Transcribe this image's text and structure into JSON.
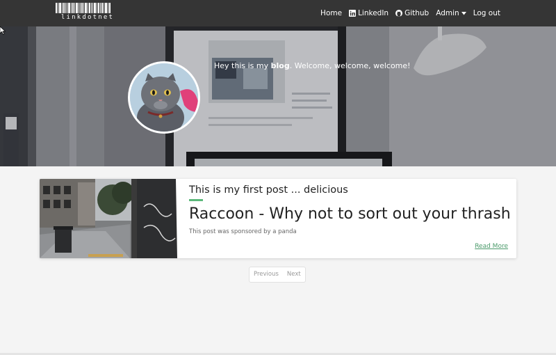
{
  "navbar": {
    "brand": "linkdotnet",
    "links": [
      {
        "label": "Home",
        "icon": "none"
      },
      {
        "label": "LinkedIn",
        "icon": "linkedin-icon"
      },
      {
        "label": "Github",
        "icon": "github-icon"
      },
      {
        "label": "Admin",
        "icon": "caret-down-icon"
      },
      {
        "label": "Log out",
        "icon": "none"
      }
    ]
  },
  "hero": {
    "intro": "Hey this is my",
    "highlight": "blog",
    "rest": ". Welcome, welcome, welcome!"
  },
  "post": {
    "subtitle": "This is my first post ... delicious",
    "title": "Raccoon - Why not to sort out your thrash",
    "description": "This post was sponsored by a panda",
    "read_more": "Read More"
  },
  "pagination": {
    "previous": "Previous",
    "next": "Next"
  },
  "colors": {
    "navbar": "#353535",
    "accent": "#5cb87a",
    "background": "#f4f4f4"
  }
}
